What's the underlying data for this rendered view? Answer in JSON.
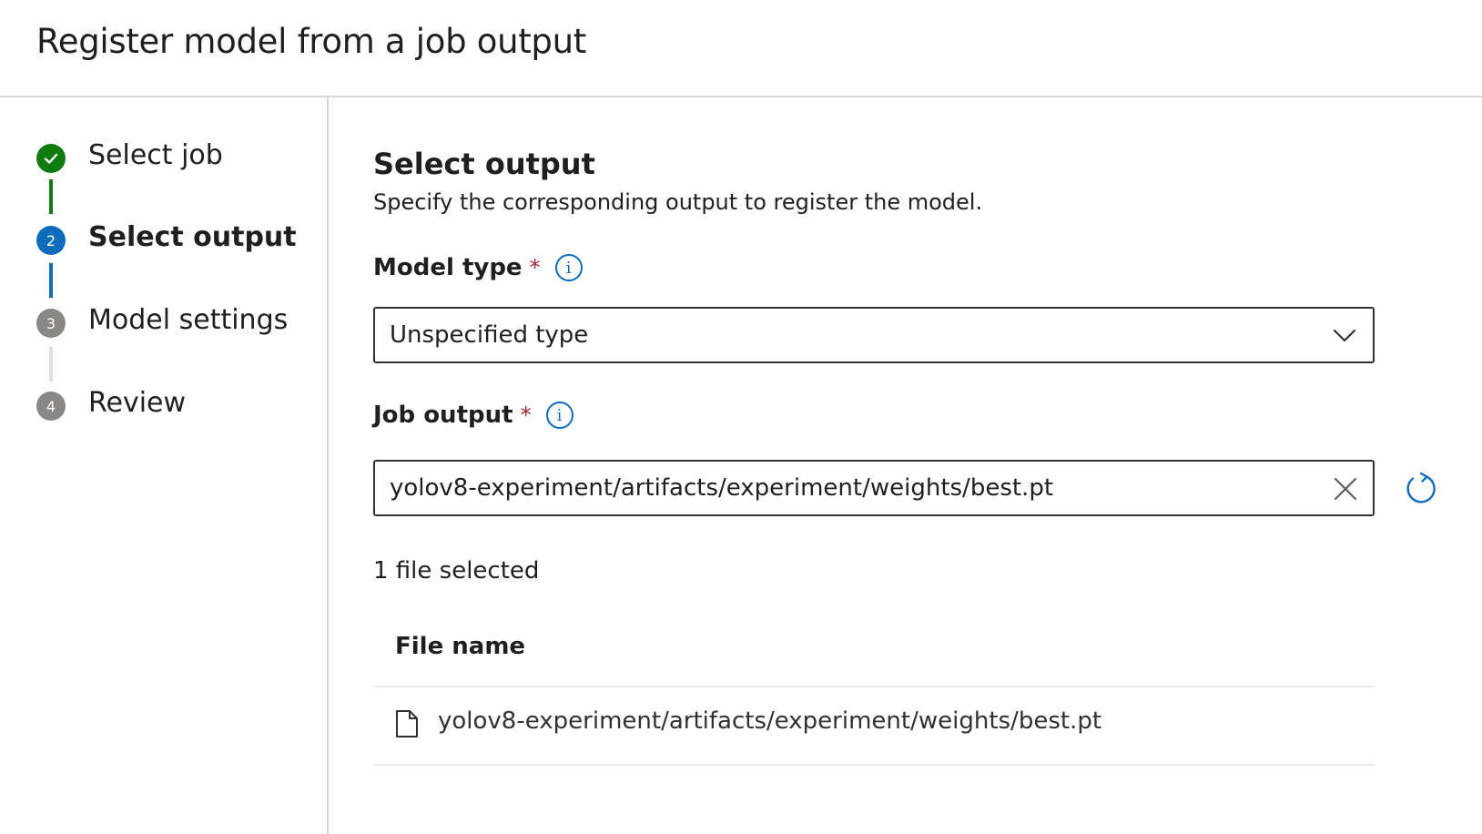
{
  "header": {
    "title": "Register model from a job output"
  },
  "wizard": {
    "steps": [
      {
        "number": "",
        "label": "Select job",
        "state": "done"
      },
      {
        "number": "2",
        "label": "Select output",
        "state": "current"
      },
      {
        "number": "3",
        "label": "Model settings",
        "state": "future"
      },
      {
        "number": "4",
        "label": "Review",
        "state": "future"
      }
    ]
  },
  "main": {
    "title": "Select output",
    "subtitle": "Specify the corresponding output to register the model.",
    "model_type": {
      "label": "Model type",
      "required_mark": "*",
      "info": "i",
      "value": "Unspecified type"
    },
    "job_output": {
      "label": "Job output",
      "required_mark": "*",
      "info": "i",
      "value": "yolov8-experiment/artifacts/experiment/weights/best.pt"
    },
    "file_count": "1 file selected",
    "table": {
      "columns": [
        "File name"
      ],
      "rows": [
        {
          "file_name": "yolov8-experiment/artifacts/experiment/weights/best.pt"
        }
      ]
    }
  },
  "colors": {
    "done": "#107c10",
    "current": "#0f6cbd",
    "future": "#8a8886",
    "required": "#a4262c"
  },
  "icons": {
    "done_step": "checkmark-icon",
    "info": "info-icon",
    "dropdown": "chevron-down-icon",
    "clear": "close-icon",
    "refresh": "refresh-icon",
    "file": "file-icon"
  }
}
